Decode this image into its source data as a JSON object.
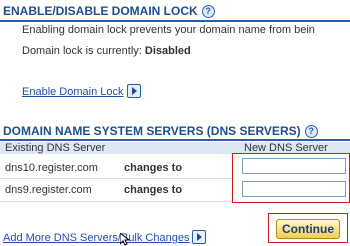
{
  "lock": {
    "title": "ENABLE/DISABLE DOMAIN LOCK",
    "description": "Enabling domain lock prevents your domain name from bein",
    "status_label": "Domain lock is currently:",
    "status_value": "Disabled",
    "enable_link": "Enable Domain Lock"
  },
  "dns": {
    "title": "DOMAIN NAME SYSTEM SERVERS (DNS SERVERS)",
    "col_existing": "Existing DNS Server",
    "col_new": "New DNS Server",
    "rows": [
      {
        "server": "dns10.register.com",
        "changes_label": "changes to",
        "new_value": ""
      },
      {
        "server": "dns9.register.com",
        "changes_label": "changes to",
        "new_value": ""
      }
    ],
    "add_more_link": "Add More DNS Servers/Bulk Changes",
    "continue_label": "Continue"
  },
  "icons": {
    "help": "?"
  },
  "colors": {
    "heading": "#1f4e8c",
    "highlight_border": "#d31a1a",
    "button_fill": "#f2cf4c"
  }
}
